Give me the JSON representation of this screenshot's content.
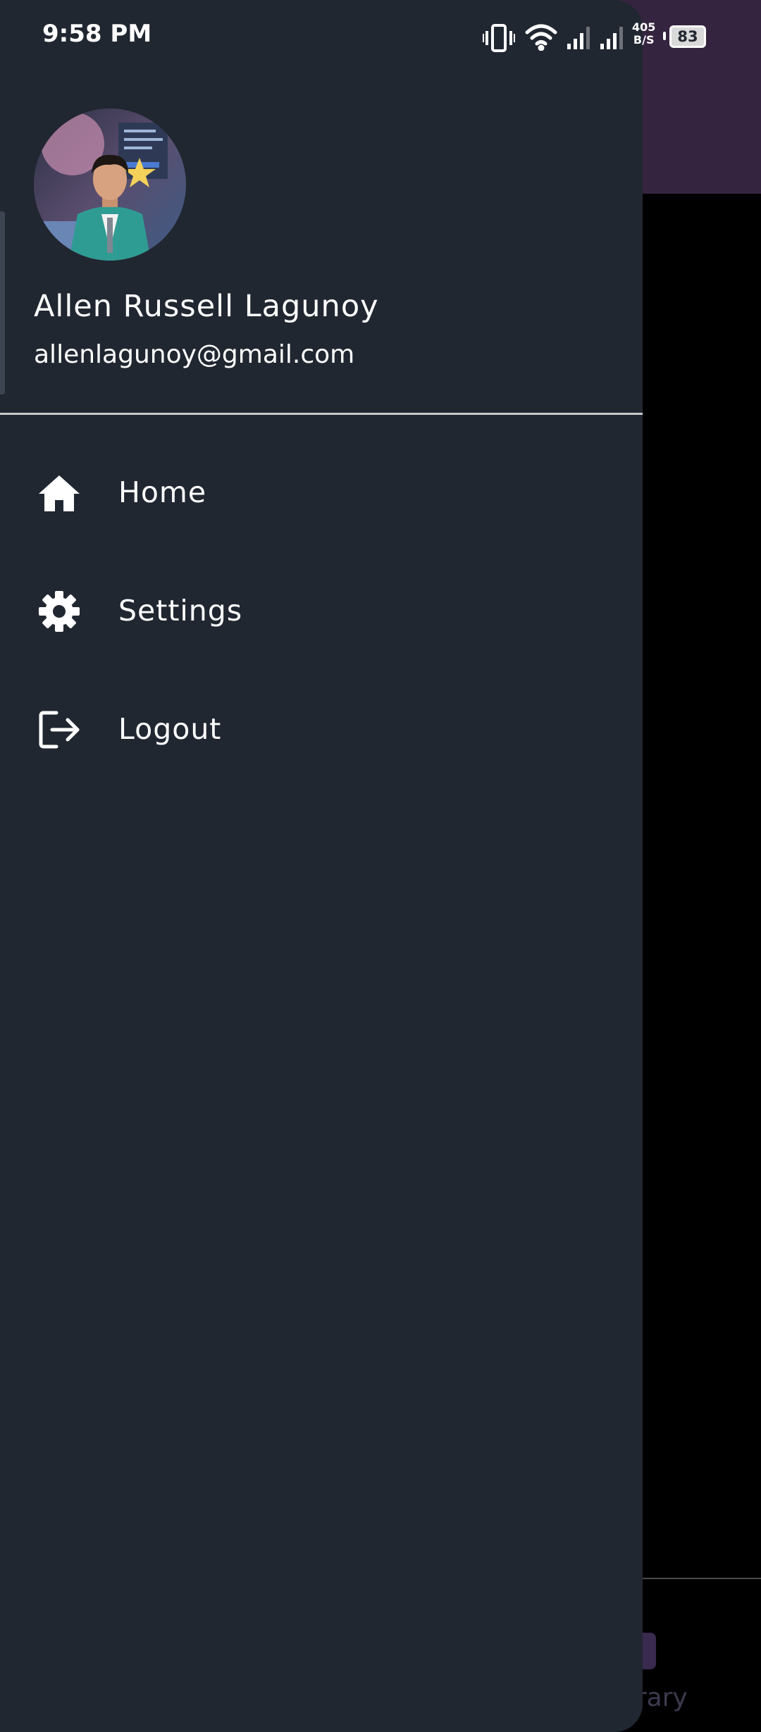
{
  "status_bar": {
    "time": "9:58 PM",
    "net_speed_value": "405",
    "net_speed_unit": "B/S",
    "battery": "83",
    "icons": [
      "vibrate-icon",
      "wifi-icon",
      "signal-icon",
      "signal-icon"
    ]
  },
  "drawer": {
    "user_name": "Allen Russell Lagunoy",
    "user_email": "allenlagunoy@gmail.com",
    "items": [
      {
        "label": "Home",
        "icon": "home-icon"
      },
      {
        "label": "Settings",
        "icon": "gear-icon"
      },
      {
        "label": "Logout",
        "icon": "logout-icon"
      }
    ]
  },
  "background": {
    "nav_label_partial": "brary"
  },
  "colors": {
    "drawer_bg": "#212731",
    "header_bg": "#35243f",
    "text": "#ffffff",
    "divider": "#c9c9c9"
  }
}
